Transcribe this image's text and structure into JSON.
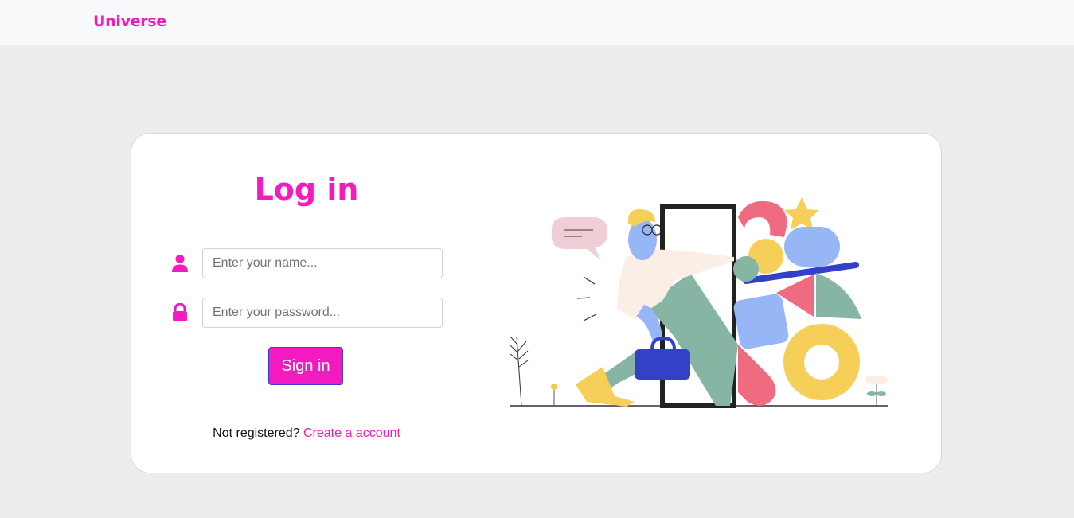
{
  "navbar": {
    "brand": "Universe"
  },
  "login": {
    "title": "Log in",
    "name_placeholder": "Enter your name...",
    "password_placeholder": "Enter your password...",
    "signin_label": "Sign in",
    "not_registered_text": "Not registered?",
    "create_account_label": "Create a account"
  },
  "icons": {
    "user": "user-icon",
    "lock": "lock-icon"
  },
  "colors": {
    "brand": "#f21bbf",
    "button_border": "#3a3ad6",
    "page_background": "#ededed",
    "navbar_background": "#f8f9fa"
  }
}
